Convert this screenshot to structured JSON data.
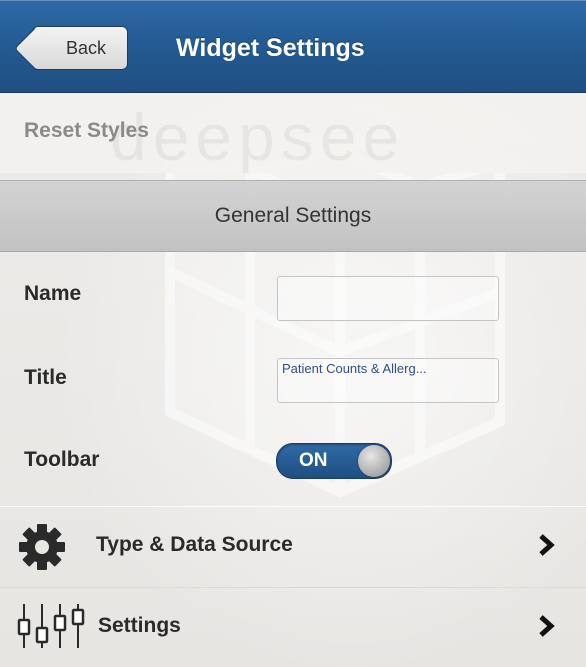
{
  "header": {
    "back_label": "Back",
    "title": "Widget Settings"
  },
  "reset": {
    "label": "Reset Styles",
    "watermark": "deepsee"
  },
  "section": {
    "title": "General Settings"
  },
  "fields": {
    "name": {
      "label": "Name",
      "value": ""
    },
    "title": {
      "label": "Title",
      "value": "Patient Counts & Allerg..."
    },
    "toolbar": {
      "label": "Toolbar",
      "state": "ON"
    }
  },
  "nav": [
    {
      "label": "Type & Data Source",
      "icon": "gear-icon"
    },
    {
      "label": "Settings",
      "icon": "sliders-icon"
    }
  ],
  "colors": {
    "header_blue": "#245b93",
    "toggle_blue": "#2f6aa6",
    "section_gray": "#c8c8c8"
  }
}
